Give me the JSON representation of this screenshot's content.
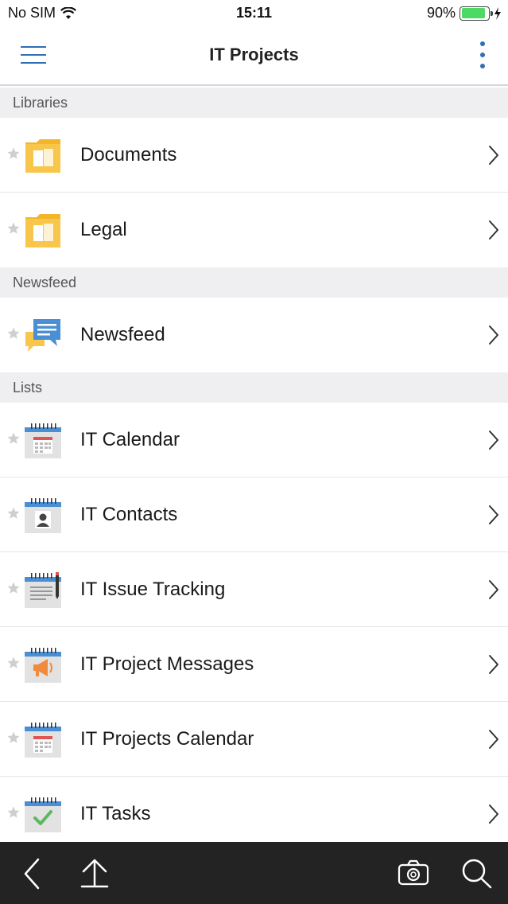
{
  "status": {
    "carrier": "No SIM",
    "time": "15:11",
    "battery": "90%",
    "battery_level": 0.9
  },
  "nav": {
    "title": "IT Projects"
  },
  "sections": [
    {
      "title": "Libraries",
      "items": [
        {
          "label": "Documents",
          "icon": "folder-icon"
        },
        {
          "label": "Legal",
          "icon": "folder-icon"
        }
      ]
    },
    {
      "title": "Newsfeed",
      "items": [
        {
          "label": "Newsfeed",
          "icon": "chat-bubbles-icon"
        }
      ]
    },
    {
      "title": "Lists",
      "items": [
        {
          "label": "IT Calendar",
          "icon": "calendar-icon"
        },
        {
          "label": "IT Contacts",
          "icon": "contacts-icon"
        },
        {
          "label": "IT Issue Tracking",
          "icon": "issue-tracking-icon"
        },
        {
          "label": "IT Project Messages",
          "icon": "megaphone-icon"
        },
        {
          "label": "IT Projects Calendar",
          "icon": "calendar-icon"
        },
        {
          "label": "IT Tasks",
          "icon": "tasks-icon"
        }
      ]
    }
  ],
  "colors": {
    "accent": "#2f6fb5",
    "folder": "#f7c64a",
    "toolbar": "#232323"
  }
}
